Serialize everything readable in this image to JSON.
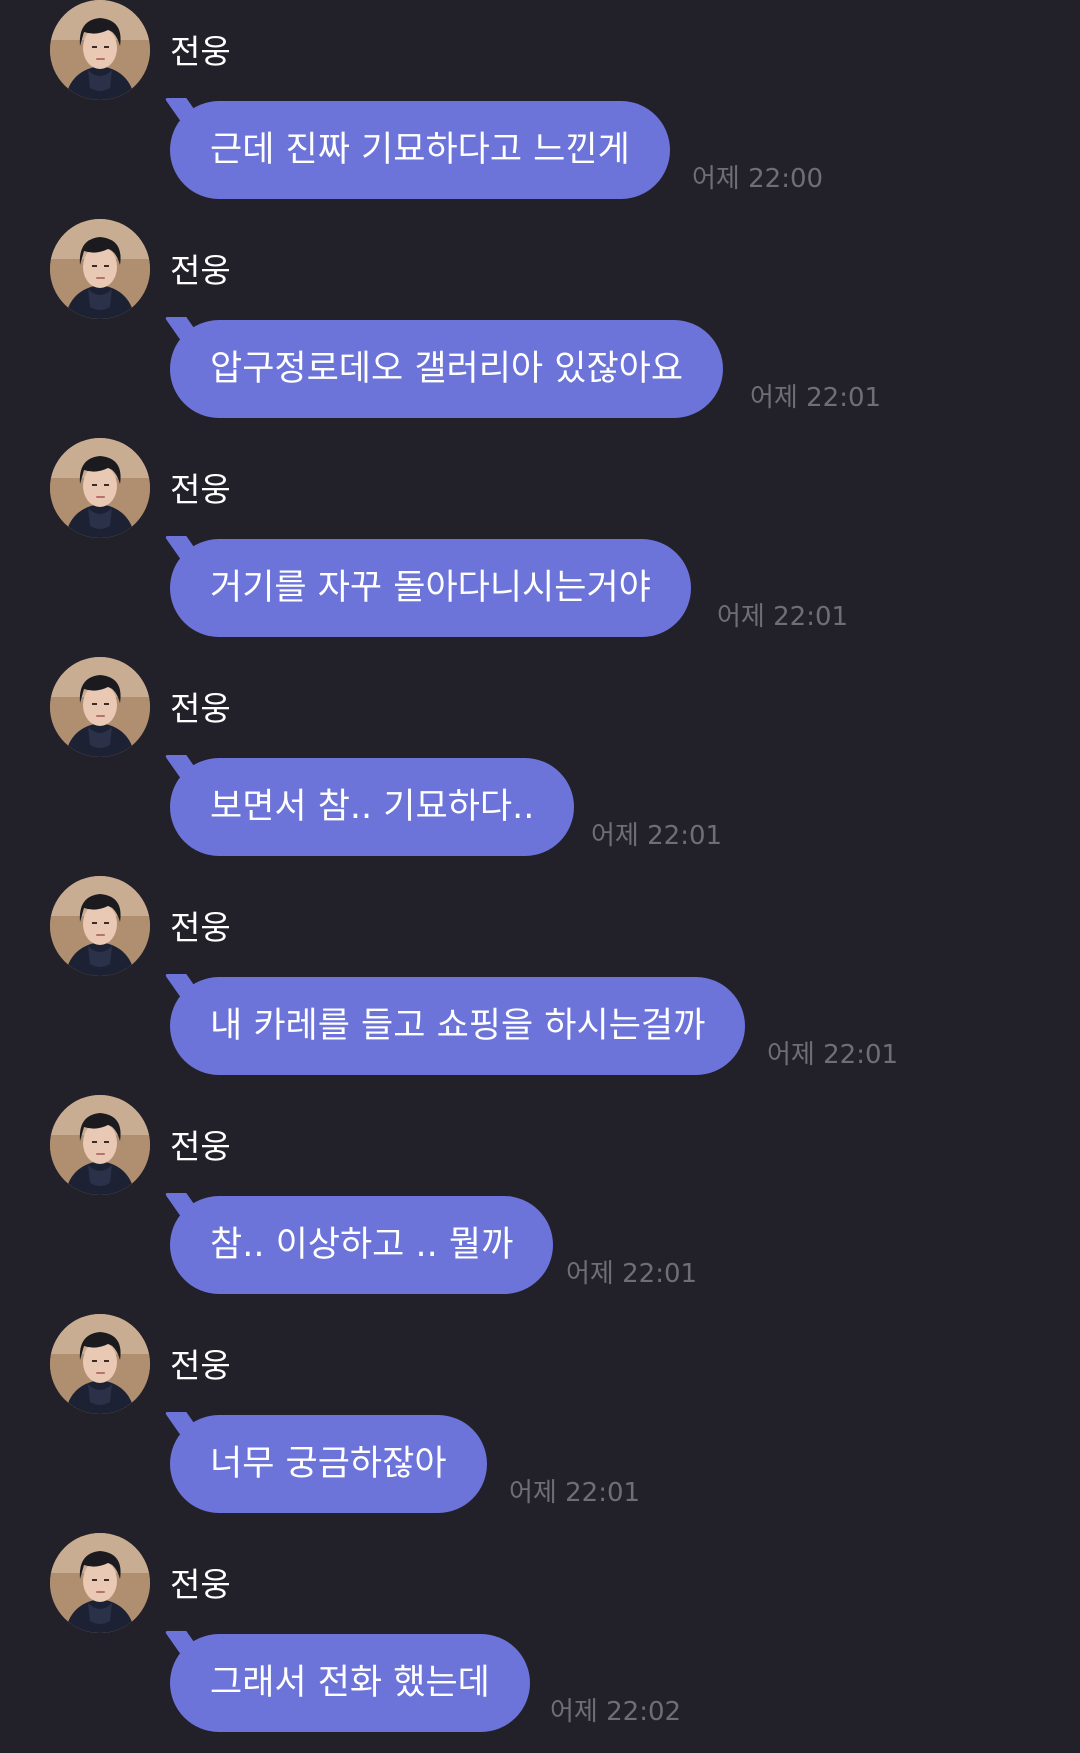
{
  "sender_name": "전웅",
  "messages": [
    {
      "text": "근데 진짜 기묘하다고 느낀게",
      "time": "어제 22:00"
    },
    {
      "text": "압구정로데오 갤러리아 있잖아요",
      "time": "어제 22:01"
    },
    {
      "text": "거기를 자꾸 돌아다니시는거야",
      "time": "어제 22:01"
    },
    {
      "text": "보면서 참.. 기묘하다..",
      "time": "어제 22:01"
    },
    {
      "text": "내 카레를 들고 쇼핑을 하시는걸까",
      "time": "어제 22:01"
    },
    {
      "text": "참.. 이상하고 .. 뭘까",
      "time": "어제 22:01"
    },
    {
      "text": "너무 궁금하잖아",
      "time": "어제 22:01"
    },
    {
      "text": "그래서 전화 했는데",
      "time": "어제 22:02"
    }
  ],
  "colors": {
    "background": "#222129",
    "bubble": "#6c73d9",
    "timestamp": "#6f6e76",
    "text": "#ffffff"
  },
  "icons": {
    "avatar": "profile-photo"
  }
}
